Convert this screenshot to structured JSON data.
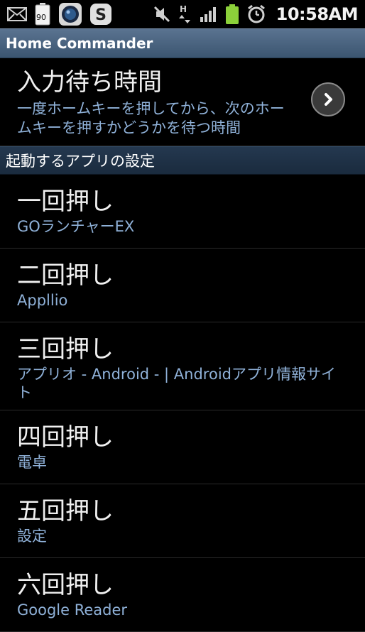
{
  "status_bar": {
    "battery_badge": "90",
    "clock": "10:58AM",
    "icons": [
      "mail-icon",
      "battery-widget-icon",
      "camera-app-icon",
      "skype-icon",
      "mute-icon",
      "hspa-data-icon",
      "signal-icon",
      "battery-icon",
      "alarm-icon"
    ]
  },
  "app_title": "Home Commander",
  "wait_pref": {
    "title": "入力待ち時間",
    "summary": "一度ホームキーを押してから、次のホームキーを押すかどうかを待つ時間"
  },
  "section": {
    "title": "起動するアプリの設定"
  },
  "items": [
    {
      "title": "一回押し",
      "summary": "GOランチャーEX"
    },
    {
      "title": "二回押し",
      "summary": "Appllio"
    },
    {
      "title": "三回押し",
      "summary": "アプリオ - Android - | Androidアプリ情報サイト"
    },
    {
      "title": "四回押し",
      "summary": "電卓"
    },
    {
      "title": "五回押し",
      "summary": "設定"
    },
    {
      "title": "六回押し",
      "summary": "Google Reader"
    }
  ],
  "colors": {
    "title_bar": "#4a6482",
    "section_header": "#1f3146",
    "summary_text": "#8fb1d8",
    "battery_green": "#8cd13a"
  }
}
